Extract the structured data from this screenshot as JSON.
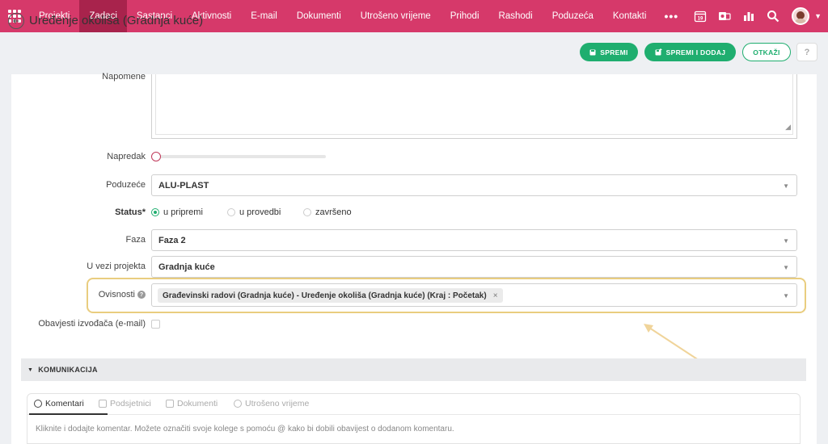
{
  "nav": {
    "items": [
      "Projekti",
      "Zadaci",
      "Sastanci",
      "Aktivnosti",
      "E-mail",
      "Dokumenti",
      "Utrošeno vrijeme",
      "Prihodi",
      "Rashodi",
      "Poduzeća",
      "Kontakti"
    ],
    "active": "Zadaci",
    "more": "•••",
    "calendar_day": "19",
    "accent": "#d6396a"
  },
  "header": {
    "title": "Uređenje okoliša (Gradnja kuće)",
    "save_label": "SPREMI",
    "save_add_label": "SPREMI I DODAJ",
    "cancel_label": "OTKAŽI",
    "help_label": "?"
  },
  "form": {
    "notes_label": "Napomene",
    "progress_label": "Napredak",
    "progress_value": 0,
    "company_label": "Poduzeće",
    "company_value": "ALU-PLAST",
    "status_label": "Status*",
    "status_options": [
      "u pripremi",
      "u provedbi",
      "završeno"
    ],
    "status_selected": "u pripremi",
    "phase_label": "Faza",
    "phase_value": "Faza 2",
    "project_label": "U vezi projekta",
    "project_value": "Gradnja kuće",
    "dependencies_label": "Ovisnosti",
    "dependency_tag": "Građevinski radovi (Gradnja kuće) - Uređenje okoliša (Gradnja kuće) (Kraj : Početak)",
    "tag_remove": "×",
    "notify_label": "Obavjesti izvođača (e-mail)"
  },
  "communication": {
    "section_title": "KOMUNIKACIJA",
    "tabs": [
      "Komentari",
      "Podsjetnici",
      "Dokumenti",
      "Utrošeno vrijeme"
    ],
    "placeholder": "Kliknite i dodajte komentar. Možete označiti svoje kolege s pomoću @ kako bi dobili obavijest o dodanom komentaru."
  }
}
